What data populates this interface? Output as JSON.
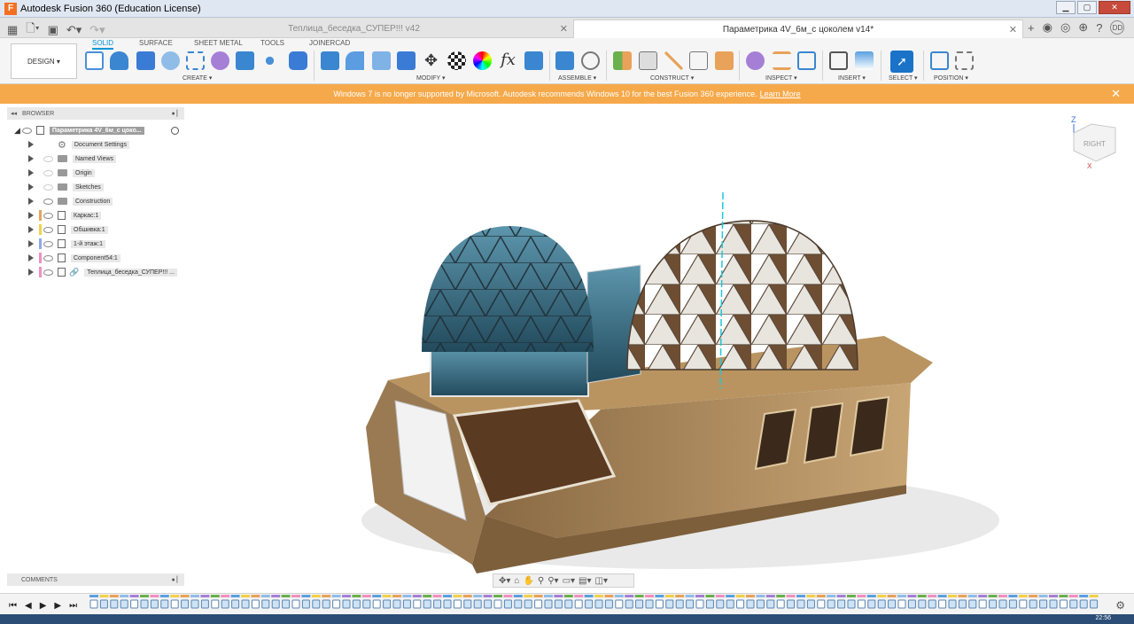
{
  "window": {
    "title": "Autodesk Fusion 360 (Education License)",
    "app_logo": "F"
  },
  "tabs": [
    {
      "label": "Теплица_беседка_СУПЕР!!! v42",
      "active": false
    },
    {
      "label": "Параметрика 4V_6м_с цоколем v14*",
      "active": true
    }
  ],
  "user_initials": "DD",
  "workspace": {
    "label": "DESIGN ▾"
  },
  "ribbon_tabs": [
    "SOLID",
    "SURFACE",
    "SHEET METAL",
    "TOOLS",
    "JOINERCAD"
  ],
  "ribbon_groups": [
    "CREATE ▾",
    "MODIFY ▾",
    "ASSEMBLE ▾",
    "CONSTRUCT ▾",
    "INSPECT ▾",
    "INSERT ▾",
    "SELECT ▾",
    "POSITION ▾"
  ],
  "notice": {
    "text": "Windows 7 is no longer supported by Microsoft. Autodesk recommends Windows 10 for the best Fusion 360 experience.",
    "link": "Learn More"
  },
  "browser": {
    "title": "BROWSER",
    "root": "Параметрика 4V_6м_с цоко...",
    "items": [
      {
        "label": "Document Settings",
        "kind": "gear"
      },
      {
        "label": "Named Views",
        "kind": "folder"
      },
      {
        "label": "Origin",
        "kind": "folder"
      },
      {
        "label": "Sketches",
        "kind": "folder"
      },
      {
        "label": "Construction",
        "kind": "folder"
      },
      {
        "label": "Каркас:1",
        "kind": "component",
        "color": "#e8a25a"
      },
      {
        "label": "Обшивка:1",
        "kind": "component",
        "color": "#f2d04a"
      },
      {
        "label": "1-й этаж:1",
        "kind": "component",
        "color": "#8fa8e8"
      },
      {
        "label": "Component54:1",
        "kind": "component",
        "color": "#f08fc0"
      },
      {
        "label": "Теплица_беседка_СУПЕР!!! ...",
        "kind": "link",
        "color": "#f08fc0"
      }
    ]
  },
  "comments": {
    "title": "COMMENTS"
  },
  "viewcube": {
    "face": "RIGHT",
    "axis_z": "Z",
    "axis_x": "X"
  },
  "clock": "22:56",
  "colors": {
    "accent": "#0696d7",
    "notice": "#f6a94a",
    "wood": "#b48f5f",
    "glass": "#2f6f86"
  }
}
